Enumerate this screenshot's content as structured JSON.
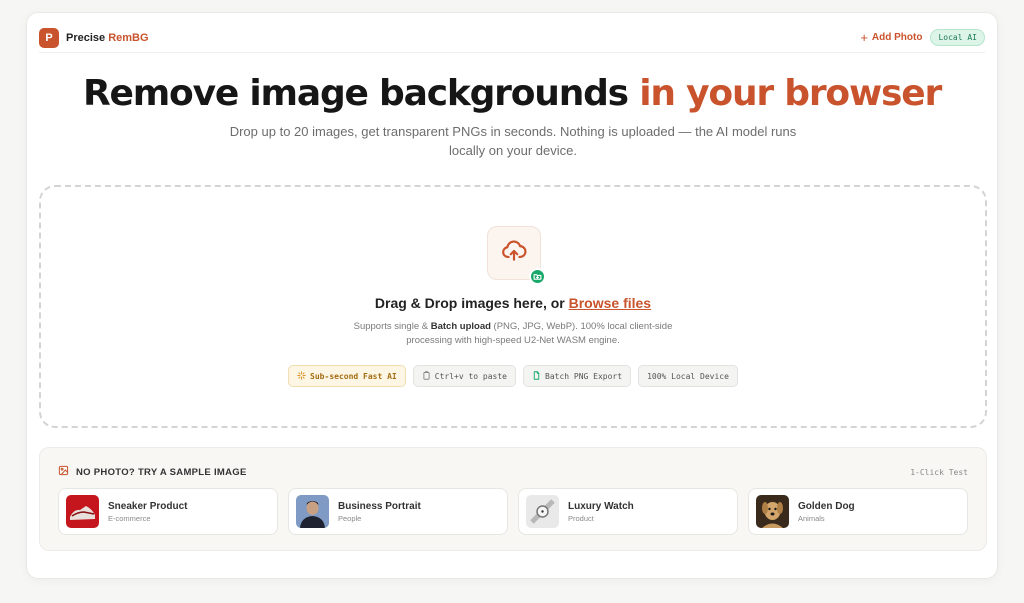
{
  "header": {
    "logo_letter": "P",
    "brand_name": "Precise",
    "brand_accent": "RemBG",
    "add_photo_label": "Add Photo",
    "local_badge": "Local AI"
  },
  "hero": {
    "title_main": "Remove image backgrounds",
    "title_accent": "in your browser",
    "subtitle": "Drop up to 20 images, get transparent PNGs in seconds. Nothing is uploaded — the AI model runs locally on your device."
  },
  "dropzone": {
    "title_prefix": "Drag & Drop images here, or",
    "browse_label": "Browse files",
    "desc_prefix": "Supports single &",
    "desc_bold": "Batch upload",
    "desc_suffix": "(PNG, JPG, WebP). 100% local client-side processing with high-speed U2-Net WASM engine.",
    "chips": [
      {
        "label": "Sub-second Fast AI",
        "icon": "sparkle-icon"
      },
      {
        "label": "Ctrl+v to paste",
        "icon": "clipboard-icon"
      },
      {
        "label": "Batch PNG Export",
        "icon": "file-icon"
      },
      {
        "label": "100% Local Device",
        "icon": ""
      }
    ]
  },
  "samples": {
    "title": "NO PHOTO? TRY A SAMPLE IMAGE",
    "badge": "1-Click Test",
    "items": [
      {
        "name": "Sneaker Product",
        "category": "E-commerce"
      },
      {
        "name": "Business Portrait",
        "category": "People"
      },
      {
        "name": "Luxury Watch",
        "category": "Product"
      },
      {
        "name": "Golden Dog",
        "category": "Animals"
      }
    ]
  },
  "colors": {
    "accent": "#c9532c",
    "success": "#1aa86a",
    "warning": "#a36d12"
  }
}
